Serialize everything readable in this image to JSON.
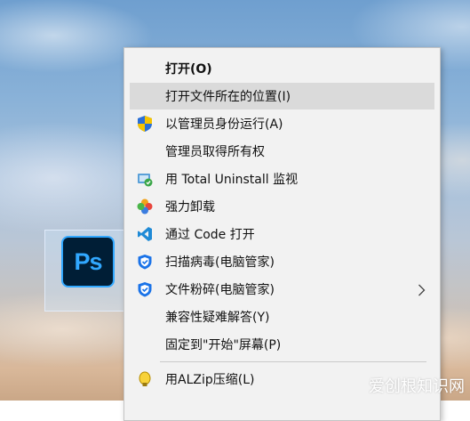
{
  "desktop_icon": {
    "app_label": "Ps"
  },
  "menu": {
    "items": [
      {
        "label": "打开(O)",
        "bold": true
      },
      {
        "label": "打开文件所在的位置(I)"
      },
      {
        "label": "以管理员身份运行(A)"
      },
      {
        "label": "管理员取得所有权"
      },
      {
        "label": "用 Total Uninstall 监视"
      },
      {
        "label": "强力卸载"
      },
      {
        "label": "通过 Code 打开"
      },
      {
        "label": "扫描病毒(电脑管家)"
      },
      {
        "label": "文件粉碎(电脑管家)"
      },
      {
        "label": "兼容性疑难解答(Y)"
      },
      {
        "label": "固定到\"开始\"屏幕(P)"
      },
      {
        "label": "用ALZip压缩(L)"
      }
    ]
  },
  "watermark": "爱创根知识网",
  "colors": {
    "menu_bg": "#f2f2f2",
    "hover_bg": "#dadada",
    "ps_blue": "#31a8ff",
    "ps_bg": "#001e36"
  },
  "icons": {
    "run_as_admin": "uac-shield-icon",
    "total_uninstall": "total-uninstall-icon",
    "force_uninstall": "clover-icon",
    "vscode": "vscode-icon",
    "scan_virus": "pc-manager-shield-icon",
    "shred": "pc-manager-shield-icon",
    "alzip": "alzip-icon"
  }
}
